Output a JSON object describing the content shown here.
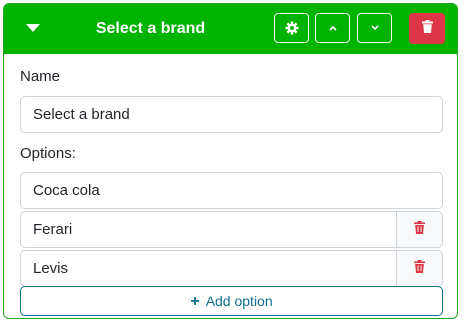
{
  "header": {
    "title": "Select a brand",
    "collapse_icon": "caret-down-icon",
    "settings_icon": "gear-icon",
    "move_up_icon": "chevron-up-icon",
    "move_down_icon": "chevron-down-icon",
    "delete_icon": "trash-icon",
    "background_color": "#00b300",
    "delete_color": "#dc3545"
  },
  "form": {
    "name_label": "Name",
    "name_value": "Select a brand",
    "options_label": "Options:",
    "options": [
      {
        "value": "Coca cola",
        "deletable": false
      },
      {
        "value": "Ferari",
        "deletable": true
      },
      {
        "value": "Levis",
        "deletable": true
      }
    ],
    "add_option_label": "Add option",
    "add_option_icon": "plus-icon",
    "accent_color": "#0d6e8f"
  }
}
